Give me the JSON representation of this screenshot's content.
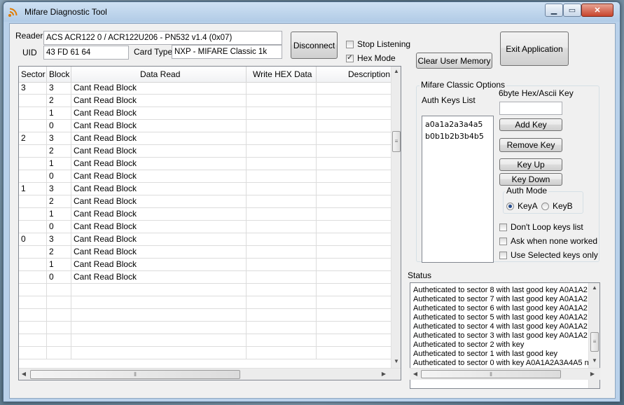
{
  "window": {
    "title": "Mifare Diagnostic Tool"
  },
  "reader": {
    "reader_label": "Reader",
    "reader_value": "ACS ACR122 0 / ACR122U206 - PN532 v1.4 (0x07)",
    "uid_label": "UID",
    "uid_value": "43 FD 61 64",
    "card_type_label": "Card Type",
    "card_type_value": "NXP - MIFARE Classic 1k",
    "disconnect_label": "Disconnect"
  },
  "options_top": {
    "stop_listening_label": "Stop Listening",
    "stop_listening_checked": false,
    "hex_mode_label": "Hex Mode",
    "hex_mode_checked": true,
    "clear_memory_label": "Clear User Memory",
    "exit_label": "Exit Application"
  },
  "grid": {
    "headers": [
      "Sector",
      "Block",
      "Data Read",
      "Write HEX Data",
      "Description"
    ],
    "rows": [
      {
        "sector": "3",
        "block": "3",
        "data": "Cant Read Block"
      },
      {
        "sector": "",
        "block": "2",
        "data": "Cant Read Block"
      },
      {
        "sector": "",
        "block": "1",
        "data": "Cant Read Block"
      },
      {
        "sector": "",
        "block": "0",
        "data": "Cant Read Block"
      },
      {
        "sector": "2",
        "block": "3",
        "data": "Cant Read Block"
      },
      {
        "sector": "",
        "block": "2",
        "data": "Cant Read Block"
      },
      {
        "sector": "",
        "block": "1",
        "data": "Cant Read Block"
      },
      {
        "sector": "",
        "block": "0",
        "data": "Cant Read Block"
      },
      {
        "sector": "1",
        "block": "3",
        "data": "Cant Read Block"
      },
      {
        "sector": "",
        "block": "2",
        "data": "Cant Read Block"
      },
      {
        "sector": "",
        "block": "1",
        "data": "Cant Read Block"
      },
      {
        "sector": "",
        "block": "0",
        "data": "Cant Read Block"
      },
      {
        "sector": "0",
        "block": "3",
        "data": "Cant Read Block"
      },
      {
        "sector": "",
        "block": "2",
        "data": "Cant Read Block"
      },
      {
        "sector": "",
        "block": "1",
        "data": "Cant Read Block"
      },
      {
        "sector": "",
        "block": "0",
        "data": "Cant Read Block"
      }
    ]
  },
  "mifare_options": {
    "group_label": "Mifare Classic Options",
    "auth_keys_label": "Auth Keys List",
    "key_input_label": "6byte Hex/Ascii Key",
    "key_input_value": "",
    "keys": [
      "a0a1a2a3a4a5",
      "b0b1b2b3b4b5"
    ],
    "add_key_label": "Add Key",
    "remove_key_label": "Remove Key",
    "key_up_label": "Key Up",
    "key_down_label": "Key Down",
    "auth_mode_label": "Auth Mode",
    "key_a_label": "KeyA",
    "key_b_label": "KeyB",
    "selected_auth_mode": "KeyA",
    "dont_loop_label": "Don't Loop keys list",
    "ask_when_none_label": "Ask when none worked",
    "use_selected_label": "Use Selected keys only"
  },
  "status": {
    "label": "Status",
    "lines": [
      "Autheticated to sector 8 with last good key A0A1A2",
      "Autheticated to sector 7 with last good key A0A1A2",
      "Autheticated to sector 6 with last good key A0A1A2",
      "Autheticated to sector 5 with last good key A0A1A2",
      "Autheticated to sector 4 with last good key A0A1A2",
      "Autheticated to sector 3 with last good key A0A1A2",
      "Autheticated to sector 2 with key",
      "Autheticated to sector 1 with last good key",
      "Autheticated to sector 0 with key A0A1A2A3A4A5 n"
    ]
  },
  "colors": {
    "titlebar": "#c4d9ee",
    "client": "#f0f0f0",
    "close_button": "#c8442c"
  }
}
